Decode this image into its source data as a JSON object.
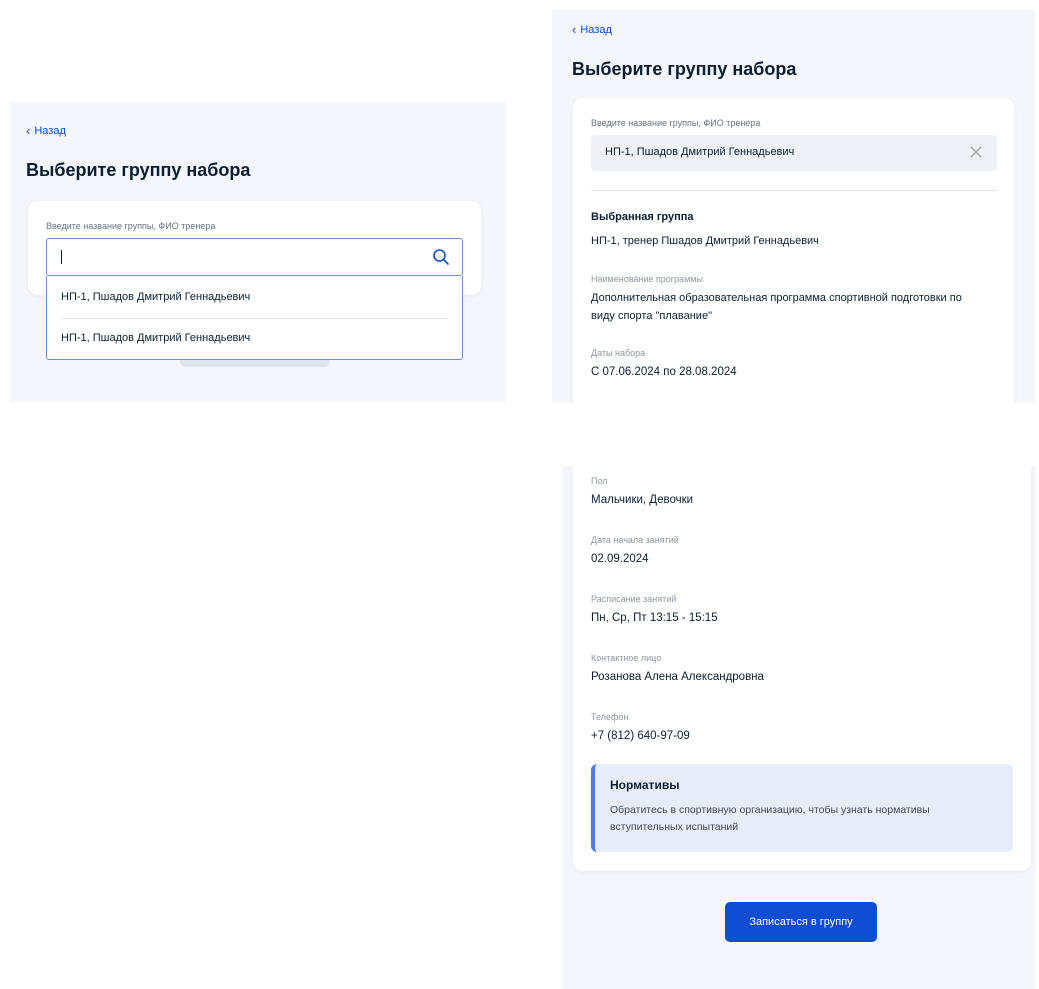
{
  "left": {
    "back_label": "Назад",
    "title": "Выберите группу набора",
    "search_label": "Введите название группы, ФИО тренера",
    "search_value": "",
    "suggestions": [
      "НП-1, Пшадов Дмитрий Геннадьевич",
      "НП-1, Пшадов Дмитрий Геннадьевич"
    ]
  },
  "right_top": {
    "back_label": "Назад",
    "title": "Выберите группу набора",
    "search_label": "Введите название группы, ФИО тренера",
    "search_value": "НП-1, Пшадов Дмитрий Геннадьевич",
    "selected_heading": "Выбранная группа",
    "selected_value": "НП-1, тренер Пшадов Дмитрий Геннадьевич",
    "program_label": "Наименование программы",
    "program_value_line1": "Дополнительная образовательная программа спортивной подготовки по",
    "program_value_line2": "виду спорта \"плавание\"",
    "dates_label": "Даты набора",
    "dates_value": "С 07.06.2024 по 28.08.2024"
  },
  "right_bottom": {
    "gender_label": "Пол",
    "gender_value": "Мальчики, Девочки",
    "start_label": "Дата начала занятий",
    "start_value": "02.09.2024",
    "schedule_label": "Расписание занятий",
    "schedule_value": "Пн, Ср, Пт 13:15 - 15:15",
    "contact_label": "Контактное лицо",
    "contact_value": "Розанова Алена Александровна",
    "phone_label": "Телефон",
    "phone_value": "+7 (812) 640-97-09",
    "note_title": "Нормативы",
    "note_text": "Обратитесь в спортивную организацию, чтобы узнать нормативы вступительных испытаний",
    "submit_label": "Записаться в группу"
  },
  "colors": {
    "accent": "#0d4cd3",
    "panel_bg": "#f4f6fb",
    "note_bg": "#e6edf9",
    "note_border": "#4a7fe0"
  },
  "icons": {
    "back": "chevron-left-icon",
    "search": "search-icon",
    "clear": "close-icon"
  }
}
